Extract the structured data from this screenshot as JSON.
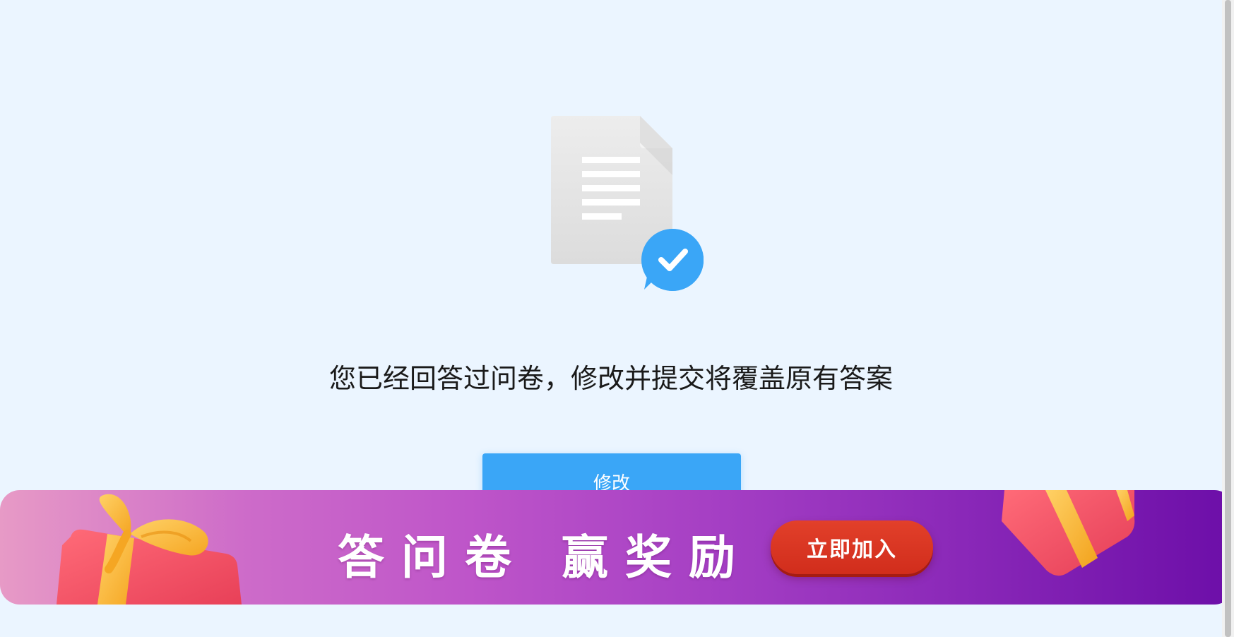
{
  "message": "您已经回答过问卷，修改并提交将覆盖原有答案",
  "modify_button_label": "修改",
  "ad": {
    "slogan": "答问卷  赢奖励",
    "join_button_label": "立即加入"
  },
  "icons": {
    "document": "document-icon",
    "check": "check-badge-icon",
    "gift": "gift-icon"
  },
  "colors": {
    "background": "#ebf5ff",
    "primary_button": "#3aa6f7",
    "check_badge": "#3aa6f7",
    "ad_join_button": "#d93320"
  }
}
